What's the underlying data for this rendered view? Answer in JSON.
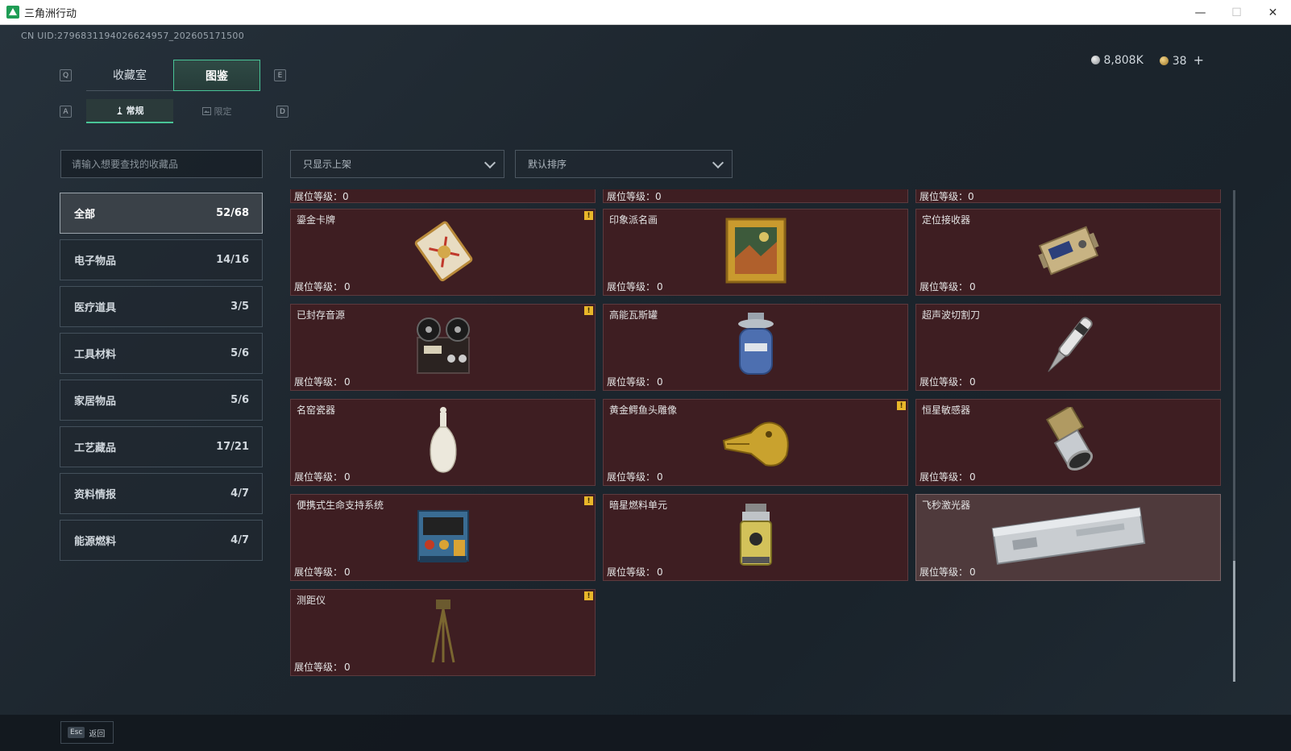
{
  "window": {
    "title": "三角洲行动",
    "min": "—",
    "max": "☐",
    "close": "✕"
  },
  "uid": "CN UID:2796831194026624957_202605171500",
  "currency": {
    "silver": "8,808K",
    "gold": "38",
    "plus": "+"
  },
  "keys": {
    "q": "Q",
    "e": "E",
    "a": "A",
    "d": "D",
    "esc": "Esc"
  },
  "tabs": {
    "collection": "收藏室",
    "catalog": "图鉴"
  },
  "subtabs": {
    "regular": "常规",
    "limited": "限定"
  },
  "search": {
    "placeholder": "请输入想要查找的收藏品"
  },
  "filters": {
    "shelf": "只显示上架",
    "sort": "默认排序"
  },
  "categories": [
    {
      "name": "全部",
      "count": "52/68"
    },
    {
      "name": "电子物品",
      "count": "14/16"
    },
    {
      "name": "医疗道具",
      "count": "3/5"
    },
    {
      "name": "工具材料",
      "count": "5/6"
    },
    {
      "name": "家居物品",
      "count": "5/6"
    },
    {
      "name": "工艺藏品",
      "count": "17/21"
    },
    {
      "name": "资料情报",
      "count": "4/7"
    },
    {
      "name": "能源燃料",
      "count": "4/7"
    }
  ],
  "level_label": "展位等级：",
  "level_value": "0",
  "items": [
    {
      "name": "鎏金卡牌",
      "icon": "gilded-card-icon",
      "badge": true
    },
    {
      "name": "印象派名画",
      "icon": "impressionist-painting-icon",
      "badge": false
    },
    {
      "name": "定位接收器",
      "icon": "gps-receiver-icon",
      "badge": false
    },
    {
      "name": "已封存音源",
      "icon": "reel-recorder-icon",
      "badge": true
    },
    {
      "name": "高能瓦斯罐",
      "icon": "gas-canister-icon",
      "badge": false
    },
    {
      "name": "超声波切割刀",
      "icon": "ultrasonic-cutter-icon",
      "badge": false
    },
    {
      "name": "名窑瓷器",
      "icon": "porcelain-vase-icon",
      "badge": false
    },
    {
      "name": "黄金鳄鱼头雕像",
      "icon": "golden-crocodile-icon",
      "badge": true
    },
    {
      "name": "恒星敏感器",
      "icon": "star-sensor-icon",
      "badge": false
    },
    {
      "name": "便携式生命支持系统",
      "icon": "life-support-icon",
      "badge": true
    },
    {
      "name": "暗星燃料单元",
      "icon": "fuel-cell-icon",
      "badge": false
    },
    {
      "name": "飞秒激光器",
      "icon": "femtosecond-laser-icon",
      "badge": false
    },
    {
      "name": "测距仪",
      "icon": "rangefinder-icon",
      "badge": true
    }
  ],
  "badge_mark": "!",
  "back_label": "返回"
}
